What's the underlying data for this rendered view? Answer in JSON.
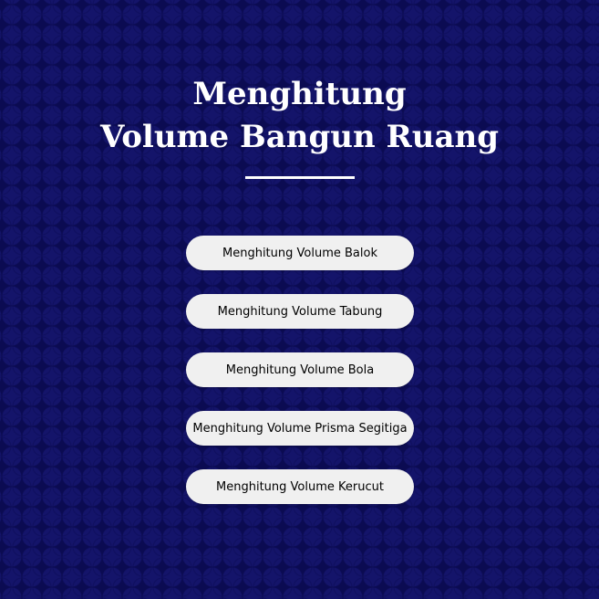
{
  "header": {
    "title_line1": "Menghitung",
    "title_line2": "Volume Bangun Ruang"
  },
  "menu": {
    "buttons": [
      {
        "label": "Menghitung Volume Balok"
      },
      {
        "label": "Menghitung Volume Tabung"
      },
      {
        "label": "Menghitung Volume Bola"
      },
      {
        "label": "Menghitung Volume Prisma Segitiga"
      },
      {
        "label": "Menghitung Volume Kerucut"
      }
    ]
  },
  "colors": {
    "background": "#0b0b52",
    "pattern": "#14146a",
    "button_bg": "#f0f0f0",
    "text_light": "#ffffff"
  }
}
